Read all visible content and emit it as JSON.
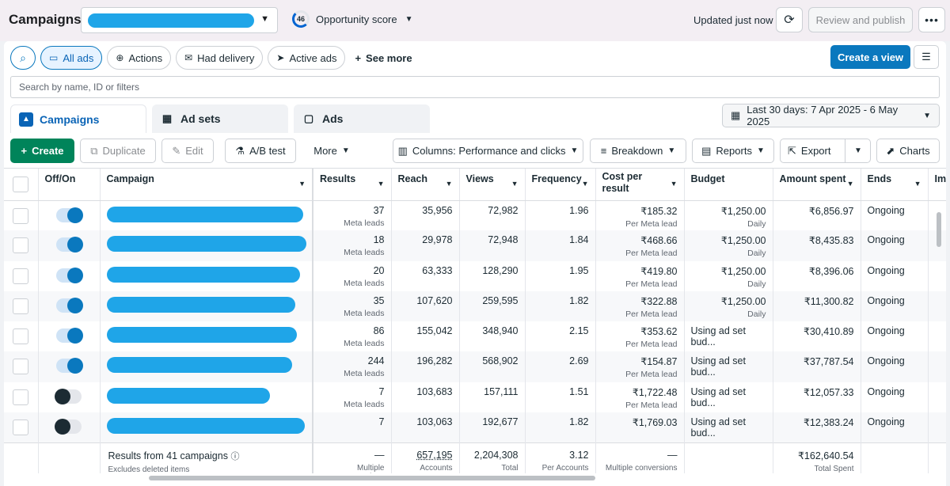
{
  "topbar": {
    "title": "Campaigns",
    "opportunity_score": "46",
    "opportunity_label": "Opportunity score",
    "updated": "Updated just now",
    "review_publish": "Review and publish"
  },
  "filters": {
    "chips": [
      "All ads",
      "Actions",
      "Had delivery",
      "Active ads"
    ],
    "see_more": "See more",
    "create_view": "Create a view",
    "search_placeholder": "Search by name, ID or filters"
  },
  "tabs": [
    "Campaigns",
    "Ad sets",
    "Ads"
  ],
  "date_range": "Last 30 days: 7 Apr 2025 - 6 May 2025",
  "toolbar": {
    "create": "Create",
    "duplicate": "Duplicate",
    "edit": "Edit",
    "ab_test": "A/B test",
    "more": "More",
    "columns": "Columns: Performance and clicks",
    "breakdown": "Breakdown",
    "reports": "Reports",
    "export": "Export",
    "charts": "Charts"
  },
  "columns": [
    "Off/On",
    "Campaign",
    "Results",
    "Reach",
    "Views",
    "Frequency",
    "Cost per result",
    "Budget",
    "Amount spent",
    "Ends",
    "Im"
  ],
  "rows": [
    {
      "on": true,
      "results": "37",
      "results_sub": "Meta leads",
      "reach": "35,956",
      "views": "72,982",
      "frequency": "1.96",
      "cost": "₹185.32",
      "cost_sub": "Per Meta lead",
      "budget": "₹1,250.00",
      "budget_sub": "Daily",
      "spent": "₹6,856.97",
      "ends": "Ongoing"
    },
    {
      "on": true,
      "results": "18",
      "results_sub": "Meta leads",
      "reach": "29,978",
      "views": "72,948",
      "frequency": "1.84",
      "cost": "₹468.66",
      "cost_sub": "Per Meta lead",
      "budget": "₹1,250.00",
      "budget_sub": "Daily",
      "spent": "₹8,435.83",
      "ends": "Ongoing"
    },
    {
      "on": true,
      "results": "20",
      "results_sub": "Meta leads",
      "reach": "63,333",
      "views": "128,290",
      "frequency": "1.95",
      "cost": "₹419.80",
      "cost_sub": "Per Meta lead",
      "budget": "₹1,250.00",
      "budget_sub": "Daily",
      "spent": "₹8,396.06",
      "ends": "Ongoing"
    },
    {
      "on": true,
      "results": "35",
      "results_sub": "Meta leads",
      "reach": "107,620",
      "views": "259,595",
      "frequency": "1.82",
      "cost": "₹322.88",
      "cost_sub": "Per Meta lead",
      "budget": "₹1,250.00",
      "budget_sub": "Daily",
      "spent": "₹11,300.82",
      "ends": "Ongoing"
    },
    {
      "on": true,
      "results": "86",
      "results_sub": "Meta leads",
      "reach": "155,042",
      "views": "348,940",
      "frequency": "2.15",
      "cost": "₹353.62",
      "cost_sub": "Per Meta lead",
      "budget": "Using ad set bud...",
      "budget_sub": "",
      "spent": "₹30,410.89",
      "ends": "Ongoing"
    },
    {
      "on": true,
      "results": "244",
      "results_sub": "Meta leads",
      "reach": "196,282",
      "views": "568,902",
      "frequency": "2.69",
      "cost": "₹154.87",
      "cost_sub": "Per Meta lead",
      "budget": "Using ad set bud...",
      "budget_sub": "",
      "spent": "₹37,787.54",
      "ends": "Ongoing"
    },
    {
      "on": false,
      "results": "7",
      "results_sub": "Meta leads",
      "reach": "103,683",
      "views": "157,111",
      "frequency": "1.51",
      "cost": "₹1,722.48",
      "cost_sub": "Per Meta lead",
      "budget": "Using ad set bud...",
      "budget_sub": "",
      "spent": "₹12,057.33",
      "ends": "Ongoing"
    },
    {
      "on": false,
      "results": "7",
      "results_sub": "",
      "reach": "103,063",
      "views": "192,677",
      "frequency": "1.82",
      "cost": "₹1,769.03",
      "cost_sub": "",
      "budget": "Using ad set bud...",
      "budget_sub": "",
      "spent": "₹12,383.24",
      "ends": "Ongoing"
    }
  ],
  "totals": {
    "label": "Results from 41 campaigns",
    "label_sub": "Excludes deleted items",
    "results": "—",
    "results_sub": "Multiple conversions",
    "reach": "657,195",
    "reach_sub": "Accounts Cent...",
    "views": "2,204,308",
    "views_sub": "Total",
    "frequency": "3.12",
    "frequency_sub": "Per Accounts C...",
    "cost": "—",
    "cost_sub": "Multiple conversions",
    "spent": "₹162,640.54",
    "spent_sub": "Total Spent"
  }
}
